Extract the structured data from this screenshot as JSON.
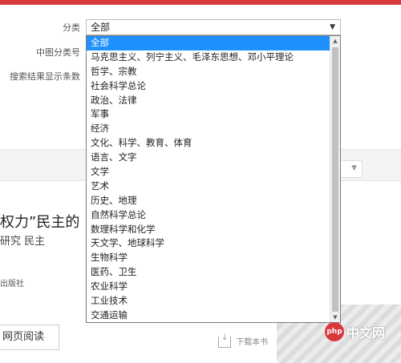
{
  "form": {
    "category_label": "分类",
    "clc_label": "中图分类号",
    "results_label": "搜索结果显示条数",
    "category_selected": "全部"
  },
  "dropdown": {
    "options": [
      "全部",
      "马克思主义、列宁主义、毛泽东思想、邓小平理论",
      "哲学、宗教",
      "社会科学总论",
      "政治、法律",
      "军事",
      "经济",
      "文化、科学、教育、体育",
      "语言、文字",
      "文学",
      "艺术",
      "历史、地理",
      "自然科学总论",
      "数理科学和化学",
      "天文学、地球科学",
      "生物科学",
      "医药、卫生",
      "农业科学",
      "工业技术",
      "交通运输"
    ],
    "selected_index": 0
  },
  "result": {
    "title_fragment": "权力”民主的",
    "subject_fragment": "研究 民主",
    "publisher_fragment": "出版社",
    "read_button": "网页阅读",
    "download_label": "下载本书"
  },
  "watermark": {
    "logo": "php",
    "text": "中文网"
  },
  "colors": {
    "accent": "#d9393e",
    "selection": "#1e90ff"
  }
}
